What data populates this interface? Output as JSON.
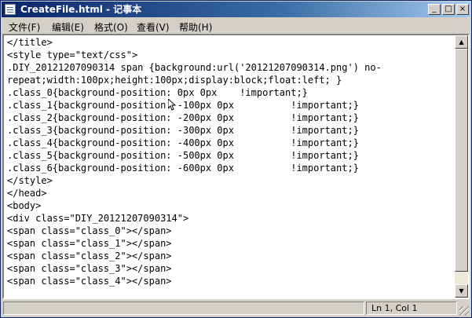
{
  "window": {
    "title": "CreateFile.html - 记事本",
    "controls": {
      "minimize": "_",
      "maximize": "□",
      "close": "×"
    }
  },
  "menu": [
    "文件(F)",
    "编辑(E)",
    "格式(O)",
    "查看(V)",
    "帮助(H)"
  ],
  "editor": {
    "lines": [
      "</title>",
      "<style type=\"text/css\">",
      ".DIY_20121207090314 span {background:url('20121207090314.png') no-",
      "repeat;width:100px;height:100px;display:block;float:left; }",
      ".class_0{background-position: 0px 0px    !important;}",
      ".class_1{background-position: -100px 0px          !important;}",
      ".class_2{background-position: -200px 0px          !important;}",
      ".class_3{background-position: -300px 0px          !important;}",
      ".class_4{background-position: -400px 0px          !important;}",
      ".class_5{background-position: -500px 0px          !important;}",
      ".class_6{background-position: -600px 0px          !important;}",
      "</style>",
      "</head>",
      "<body>",
      "<div class=\"DIY_20121207090314\">",
      "<span class=\"class_0\"></span>",
      "<span class=\"class_1\"></span>",
      "<span class=\"class_2\"></span>",
      "<span class=\"class_3\"></span>",
      "<span class=\"class_4\"></span>"
    ]
  },
  "scrollbar": {
    "up": "▲",
    "down": "▼"
  },
  "status": {
    "position": "Ln 1, Col 1"
  }
}
